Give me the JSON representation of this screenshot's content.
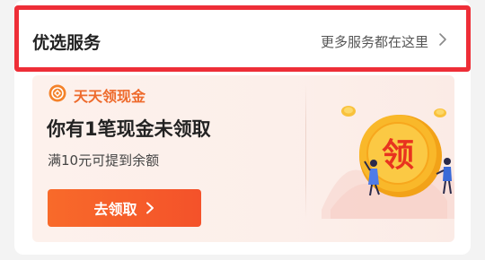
{
  "section": {
    "title": "优选服务",
    "more_label": "更多服务都在这里"
  },
  "promo": {
    "brand": "天天领现金",
    "headline": "你有1笔现金未领取",
    "subline": "满10元可提到余额",
    "cta_label": "去领取",
    "badge_char": "领"
  },
  "colors": {
    "highlight_border": "#ee2e37",
    "accent_orange": "#f4522a",
    "brand_orange": "#ee6a2c",
    "coin_gold": "#f9b82a"
  },
  "icons": [
    "chevron-right-icon",
    "coin-brand-icon",
    "coin-illustration"
  ]
}
